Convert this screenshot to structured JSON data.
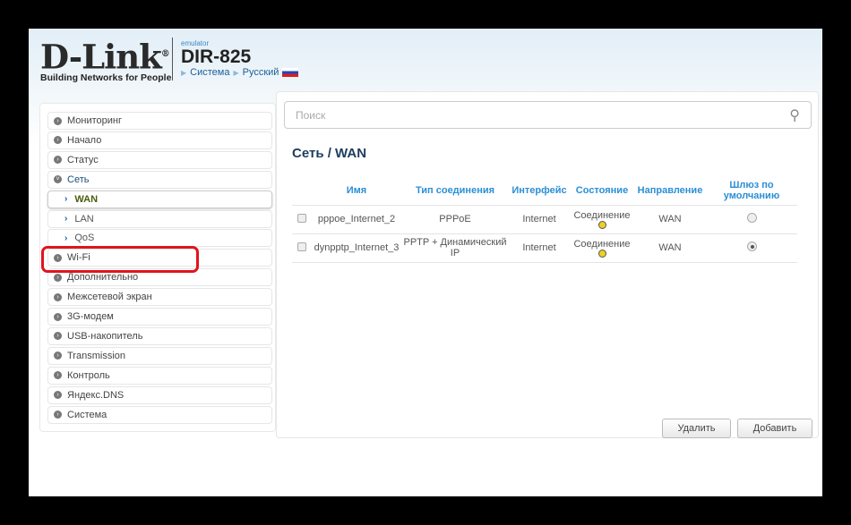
{
  "header": {
    "logo": "D-Link",
    "logo_trademark": "®",
    "tagline": "Building Networks for People",
    "emulator_label": "emulator",
    "model": "DIR-825",
    "breadcrumb": [
      "Система",
      "Русский"
    ]
  },
  "sidebar": {
    "items": [
      {
        "label": "Мониторинг"
      },
      {
        "label": "Начало"
      },
      {
        "label": "Статус"
      },
      {
        "label": "Сеть"
      },
      {
        "label": "WAN"
      },
      {
        "label": "LAN"
      },
      {
        "label": "QoS"
      },
      {
        "label": "Wi-Fi"
      },
      {
        "label": "Дополнительно"
      },
      {
        "label": "Межсетевой экран"
      },
      {
        "label": "3G-модем"
      },
      {
        "label": "USB-накопитель"
      },
      {
        "label": "Transmission"
      },
      {
        "label": "Контроль"
      },
      {
        "label": "Яндекс.DNS"
      },
      {
        "label": "Система"
      }
    ]
  },
  "highlight_color": "#e0141c",
  "main": {
    "search_placeholder": "Поиск",
    "title": "Сеть /  WAN",
    "columns": [
      "Имя",
      "Тип соединения",
      "Интерфейс",
      "Состояние",
      "Направление",
      "Шлюз по умолчанию"
    ],
    "rows": [
      {
        "name": "pppoe_Internet_2",
        "type": "PPPoE",
        "interface": "Internet",
        "state": "Соединение",
        "direction": "WAN",
        "default_gw": false
      },
      {
        "name": "dynpptp_Internet_3",
        "type": "PPTP + Динамический IP",
        "interface": "Internet",
        "state": "Соединение",
        "direction": "WAN",
        "default_gw": true
      }
    ],
    "delete_label": "Удалить",
    "add_label": "Добавить"
  }
}
